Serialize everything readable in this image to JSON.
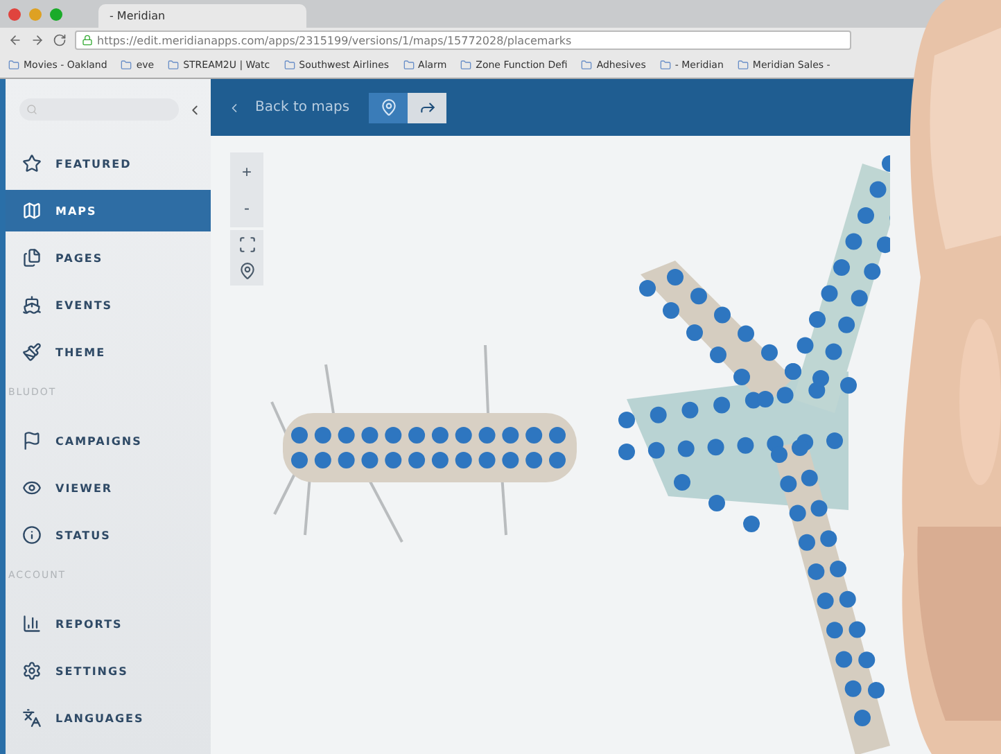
{
  "browser": {
    "tab_title": "- Meridian",
    "url": "https://edit.meridianapps.com/apps/2315199/versions/1/maps/15772028/placemarks",
    "bookmarks": [
      "Movies - Oakland",
      "eve",
      "STREAM2U | Watc",
      "Southwest Airlines",
      "Alarm",
      "Zone Function Defi",
      "Adhesives",
      "- Meridian",
      "Meridian Sales -"
    ]
  },
  "sidebar": {
    "sections": [
      {
        "items": [
          {
            "label": "FEATURED",
            "selected": false
          },
          {
            "label": "MAPS",
            "selected": true
          },
          {
            "label": "PAGES",
            "selected": false
          },
          {
            "label": "EVENTS",
            "selected": false
          },
          {
            "label": "THEME",
            "selected": false
          }
        ]
      },
      {
        "label": "BLUDOT",
        "items": [
          {
            "label": "CAMPAIGNS",
            "selected": false
          },
          {
            "label": "VIEWER",
            "selected": false
          },
          {
            "label": "STATUS",
            "selected": false
          }
        ]
      },
      {
        "label": "ACCOUNT",
        "items": [
          {
            "label": "REPORTS",
            "selected": false
          },
          {
            "label": "SETTINGS",
            "selected": false
          },
          {
            "label": "LANGUAGES",
            "selected": false
          }
        ]
      }
    ]
  },
  "toolbar": {
    "back_link": "Back to maps",
    "modes": [
      {
        "selected": true
      },
      {
        "selected": false
      }
    ]
  },
  "map_controls": {
    "zoom_in": "+",
    "zoom_out": "-"
  }
}
